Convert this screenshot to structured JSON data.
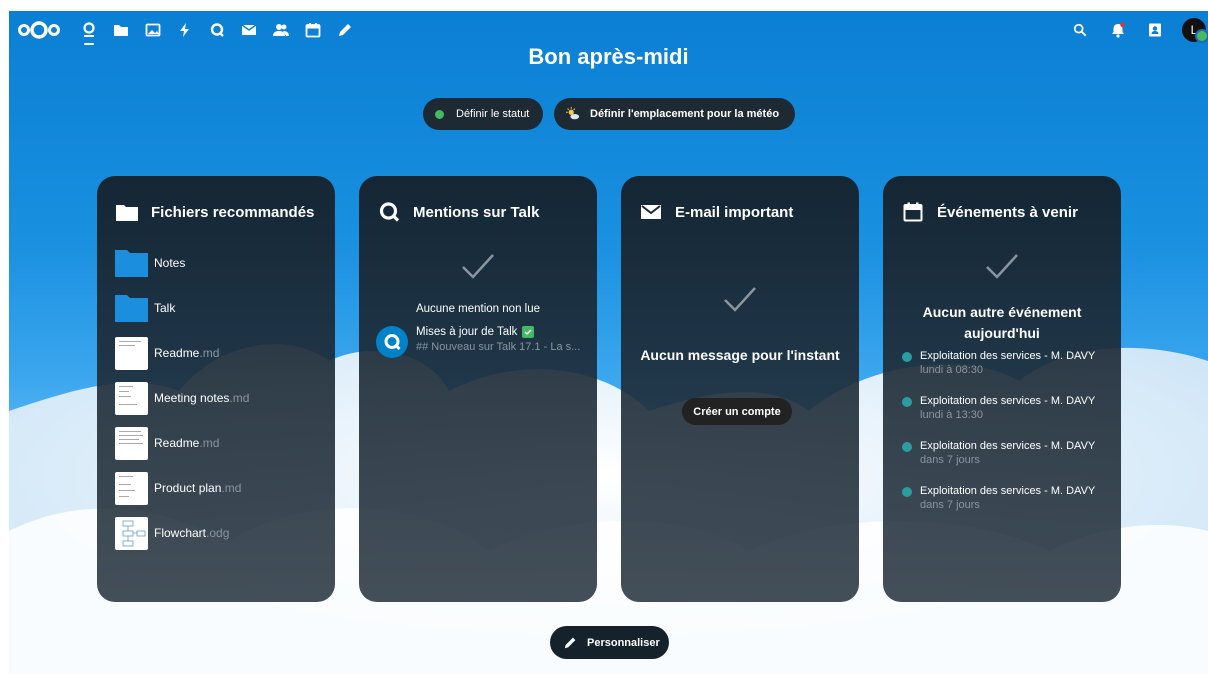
{
  "apps": [
    {
      "icon": "dashboard-icon",
      "active": true
    },
    {
      "icon": "folder-icon"
    },
    {
      "icon": "image-icon"
    },
    {
      "icon": "bolt-icon"
    },
    {
      "icon": "talk-icon"
    },
    {
      "icon": "mail-icon"
    },
    {
      "icon": "contacts-icon"
    },
    {
      "icon": "calendar-icon"
    },
    {
      "icon": "pencil-icon"
    }
  ],
  "header": {
    "avatar_initial": "L"
  },
  "greeting": "Bon après-midi",
  "status_button": "Définir le statut",
  "weather_button": "Définir l'emplacement pour la météo",
  "files_widget": {
    "title": "Fichiers recommandés",
    "items": [
      {
        "name": "Notes",
        "ext": "",
        "type": "folder"
      },
      {
        "name": "Talk",
        "ext": "",
        "type": "folder"
      },
      {
        "name": "Readme",
        "ext": ".md",
        "type": "doc"
      },
      {
        "name": "Meeting notes",
        "ext": ".md",
        "type": "doc"
      },
      {
        "name": "Readme",
        "ext": ".md",
        "type": "doc"
      },
      {
        "name": "Product plan",
        "ext": ".md",
        "type": "doc"
      },
      {
        "name": "Flowchart",
        "ext": ".odg",
        "type": "chart"
      }
    ]
  },
  "talk_widget": {
    "title": "Mentions sur Talk",
    "empty": "Aucune mention non lue",
    "item_title": "Mises à jour de Talk",
    "item_sub": "## Nouveau sur Talk 17.1 - La s..."
  },
  "mail_widget": {
    "title": "E-mail important",
    "empty": "Aucun message pour l'instant",
    "button": "Créer un compte"
  },
  "events_widget": {
    "title": "Événements à venir",
    "empty": "Aucun autre événement aujourd'hui",
    "events": [
      {
        "title": "Exploitation des services - M. DAVY",
        "time": "lundi à 08:30"
      },
      {
        "title": "Exploitation des services - M. DAVY",
        "time": "lundi à 13:30"
      },
      {
        "title": "Exploitation des services - M. DAVY",
        "time": "dans 7 jours"
      },
      {
        "title": "Exploitation des services - M. DAVY",
        "time": "dans 7 jours"
      }
    ]
  },
  "customize_button": "Personnaliser",
  "colors": {
    "accent": "#0082c9",
    "status_online": "#46ba61",
    "event_dot": "#2c9ca0"
  }
}
